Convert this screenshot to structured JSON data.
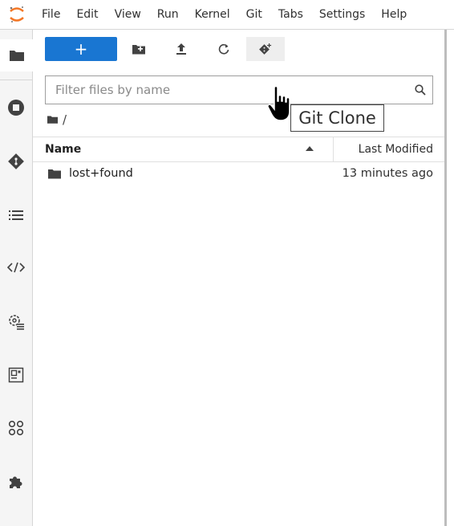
{
  "menu": [
    "File",
    "Edit",
    "View",
    "Run",
    "Kernel",
    "Git",
    "Tabs",
    "Settings",
    "Help"
  ],
  "toolbar": {
    "new_label": "+",
    "new_folder_icon": "new-folder-icon",
    "upload_icon": "upload-icon",
    "refresh_icon": "refresh-icon",
    "git_clone_icon": "git-clone-icon"
  },
  "tooltip": "Git Clone",
  "filter": {
    "placeholder": "Filter files by name",
    "value": ""
  },
  "breadcrumb": {
    "path": "/"
  },
  "columns": {
    "name": "Name",
    "modified": "Last Modified"
  },
  "files": [
    {
      "name": "lost+found",
      "modified": "13 minutes ago",
      "type": "folder"
    }
  ],
  "sidebar_icons": [
    "folder-icon",
    "running-icon",
    "git-icon",
    "toc-icon",
    "code-icon",
    "property-inspector-icon",
    "commands-icon",
    "extensions-icon",
    "puzzle-icon"
  ],
  "colors": {
    "accent": "#1976d2",
    "sidebar_bg": "#f5f5f5",
    "logo": "#f37726"
  }
}
